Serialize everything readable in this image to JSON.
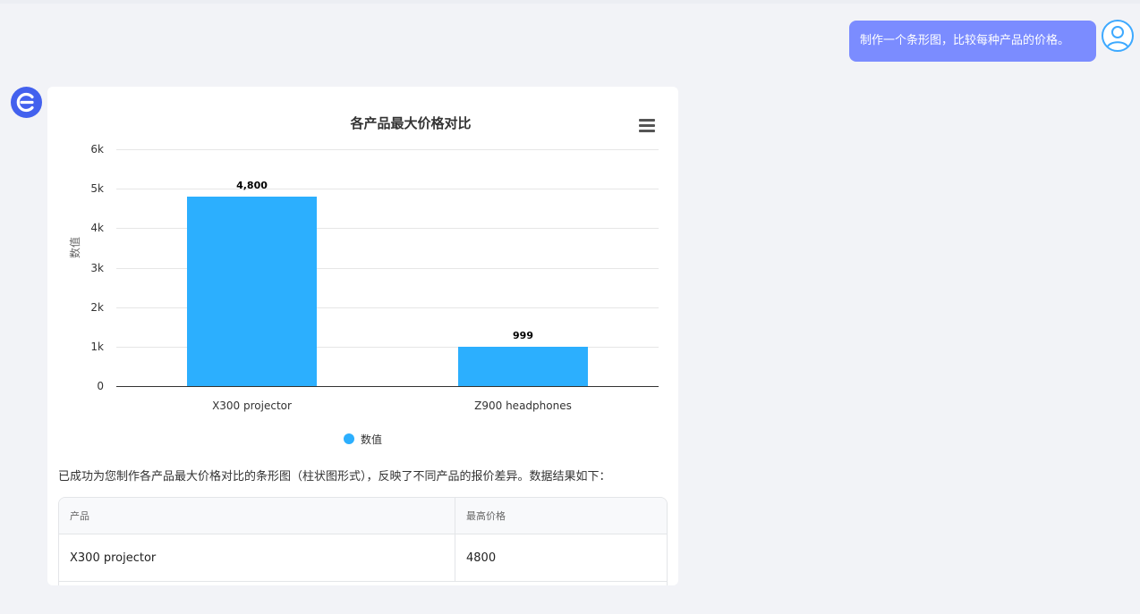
{
  "user_message": {
    "text": "制作一个条形图，比较每种产品的价格。"
  },
  "chart_data": {
    "type": "bar",
    "title": "各产品最大价格对比",
    "ylabel": "数值",
    "xlabel": "",
    "categories": [
      "X300 projector",
      "Z900 headphones"
    ],
    "series": [
      {
        "name": "数值",
        "values": [
          4800,
          999
        ],
        "data_labels": [
          "4,800",
          "999"
        ],
        "color": "#2caffe"
      }
    ],
    "ylim": [
      0,
      6000
    ],
    "yticks": [
      {
        "value": 0,
        "label": "0"
      },
      {
        "value": 1000,
        "label": "1k"
      },
      {
        "value": 2000,
        "label": "2k"
      },
      {
        "value": 3000,
        "label": "3k"
      },
      {
        "value": 4000,
        "label": "4k"
      },
      {
        "value": 5000,
        "label": "5k"
      },
      {
        "value": 6000,
        "label": "6k"
      }
    ],
    "grid": true,
    "legend_position": "bottom-center"
  },
  "answer": {
    "text": "已成功为您制作各产品最大价格对比的条形图（柱状图形式），反映了不同产品的报价差异。数据结果如下："
  },
  "table": {
    "headers": [
      "产品",
      "最高价格"
    ],
    "rows": [
      [
        "X300 projector",
        "4800"
      ]
    ]
  },
  "colors": {
    "user_bubble": "#7b8cff",
    "bot_avatar": "#4361ee",
    "series": "#2caffe",
    "background": "#f2f3f7"
  },
  "icons": {
    "user_avatar": "user-icon",
    "bot_avatar": "bot-logo-icon",
    "chart_menu": "hamburger-menu-icon"
  }
}
